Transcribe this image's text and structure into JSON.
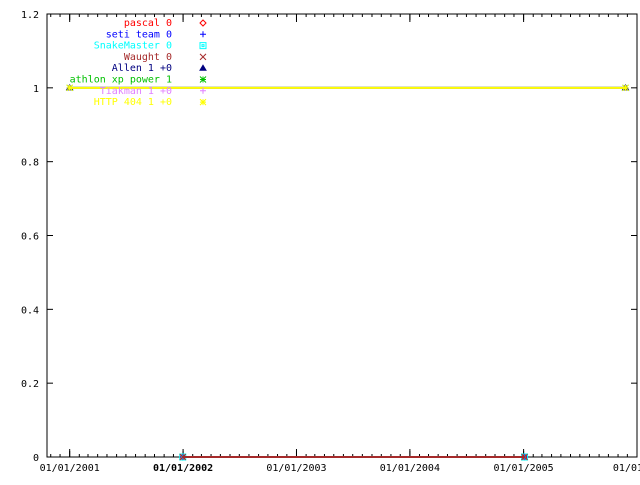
{
  "chart_data": {
    "type": "line",
    "title": "",
    "xlabel": "",
    "ylabel": "",
    "x_scale": "time",
    "xlim": [
      "2000-10-20",
      "2006-01-01"
    ],
    "ylim": [
      0,
      1.2
    ],
    "yticks": [
      {
        "value": 0,
        "label": "0"
      },
      {
        "value": 0.2,
        "label": "0.2"
      },
      {
        "value": 0.4,
        "label": "0.4"
      },
      {
        "value": 0.6,
        "label": "0.6"
      },
      {
        "value": 0.8,
        "label": "0.8"
      },
      {
        "value": 1,
        "label": "1"
      },
      {
        "value": 1.2,
        "label": "1.2"
      }
    ],
    "xticks": [
      {
        "date": "2001-01-01",
        "label": "01/01/2001",
        "bold": false
      },
      {
        "date": "2002-01-01",
        "label": "01/01/2002",
        "bold": true
      },
      {
        "date": "2003-01-01",
        "label": "01/01/2003",
        "bold": false
      },
      {
        "date": "2004-01-01",
        "label": "01/01/2004",
        "bold": false
      },
      {
        "date": "2005-01-01",
        "label": "01/01/2005",
        "bold": false
      },
      {
        "date": "2006-01-01",
        "label": "01/01/20",
        "bold": false
      }
    ],
    "grid": false,
    "legend_position": "top-left",
    "series": [
      {
        "name": "pascal",
        "legend_label": "pascal  0",
        "color": "#ff0000",
        "marker": "diamond",
        "points": [
          [
            "2001-12-31",
            0
          ],
          [
            "2005-01-04",
            0
          ]
        ]
      },
      {
        "name": "seti team",
        "legend_label": "seti team 0",
        "color": "#0000ff",
        "marker": "plus",
        "points": [
          [
            "2001-12-31",
            0
          ],
          [
            "2005-01-04",
            0
          ]
        ]
      },
      {
        "name": "SnakeMaster",
        "legend_label": "SnakeMaster 0",
        "color": "#00ffff",
        "marker": "square",
        "points": [
          [
            "2001-12-31",
            0
          ],
          [
            "2005-01-04",
            0
          ]
        ]
      },
      {
        "name": "Waught",
        "legend_label": "Waught 0",
        "color": "#a52a2a",
        "marker": "cross",
        "points": [
          [
            "2001-12-31",
            0
          ],
          [
            "2005-01-04",
            0
          ]
        ]
      },
      {
        "name": "Allen",
        "legend_label": "Allen 1 +0",
        "color": "#000080",
        "marker": "triangle",
        "points": [
          [
            "2001-01-01",
            1
          ],
          [
            "2005-11-25",
            1
          ]
        ]
      },
      {
        "name": "athlon xp power",
        "legend_label": "athlon xp power 1",
        "color": "#00c000",
        "marker": "star",
        "points": [
          [
            "2001-01-01",
            1
          ],
          [
            "2005-11-25",
            1
          ]
        ]
      },
      {
        "name": "Tiakman",
        "legend_label": "Tiakman 1 +0",
        "color": "#e080ff",
        "marker": "plus",
        "points": [
          [
            "2001-01-01",
            1
          ],
          [
            "2005-11-25",
            1
          ]
        ]
      },
      {
        "name": "HTTP 404",
        "legend_label": "HTTP 404 1 +0",
        "color": "#ffff00",
        "marker": "star",
        "points": [
          [
            "2001-01-01",
            1
          ],
          [
            "2005-11-25",
            1
          ]
        ]
      }
    ]
  }
}
